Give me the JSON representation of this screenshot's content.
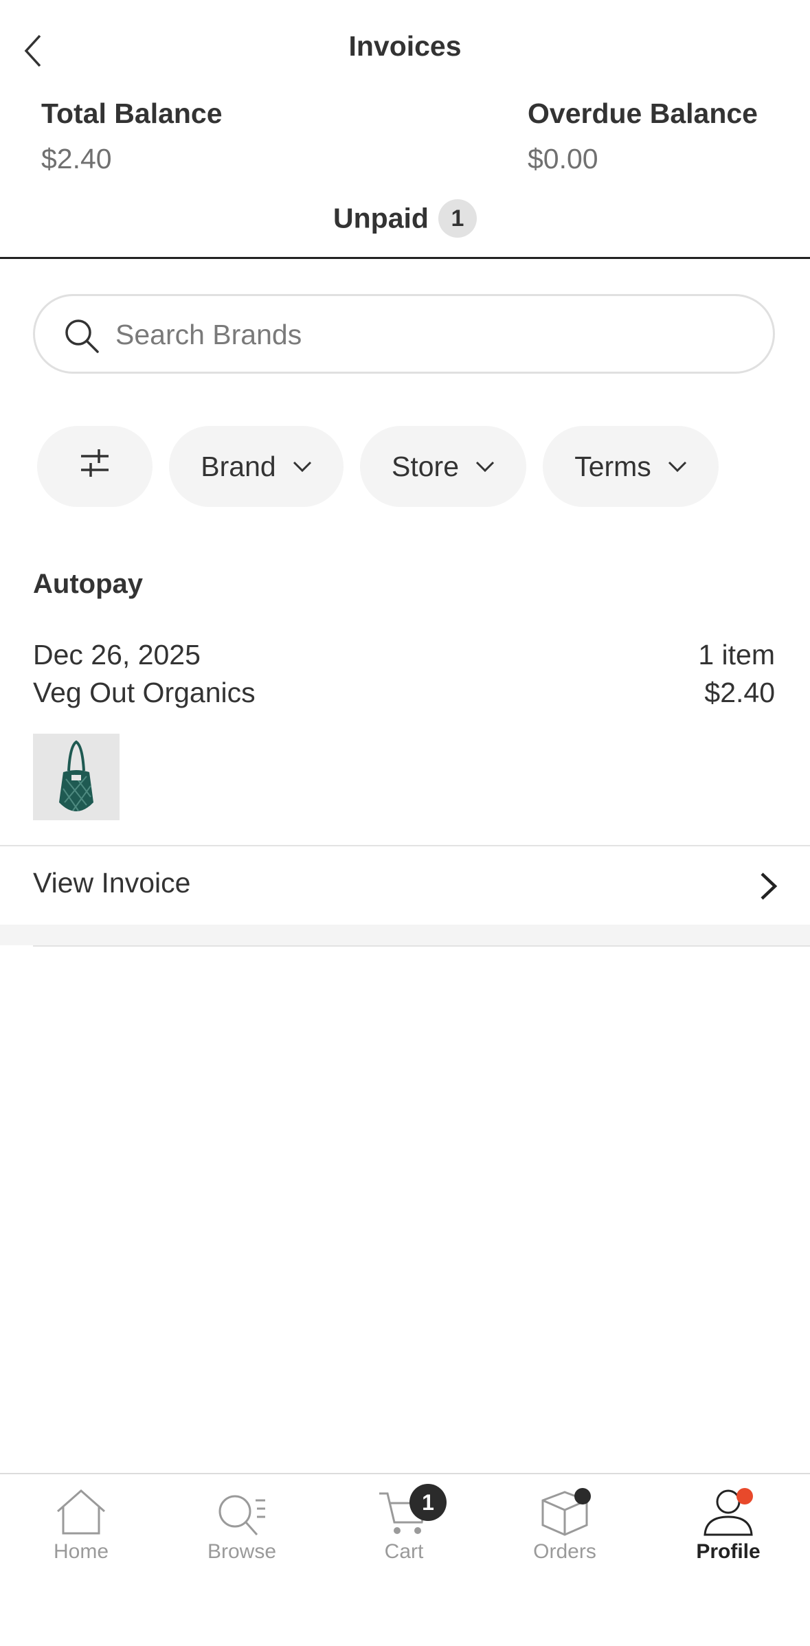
{
  "header": {
    "title": "Invoices"
  },
  "balances": {
    "total_label": "Total Balance",
    "total_value": "$2.40",
    "overdue_label": "Overdue Balance",
    "overdue_value": "$0.00"
  },
  "tabs": {
    "label": "Unpaid",
    "count": "1"
  },
  "search": {
    "placeholder": "Search Brands",
    "value": ""
  },
  "filters": [
    {
      "label": "Brand"
    },
    {
      "label": "Store"
    },
    {
      "label": "Terms"
    }
  ],
  "section": {
    "title": "Autopay",
    "invoice": {
      "date": "Dec 26, 2025",
      "store": "Veg Out Organics",
      "items": "1 item",
      "amount": "$2.40",
      "action_label": "View Invoice"
    }
  },
  "nav": {
    "items": [
      {
        "label": "Home",
        "icon": "home-icon"
      },
      {
        "label": "Browse",
        "icon": "browse-icon"
      },
      {
        "label": "Cart",
        "icon": "cart-icon",
        "badge": "1"
      },
      {
        "label": "Orders",
        "icon": "box-icon"
      },
      {
        "label": "Profile",
        "icon": "profile-icon",
        "active": true
      }
    ]
  },
  "colors": {
    "accent_dot_profile": "#e8492b",
    "dot_orders": "#2b2b2b",
    "product_green": "#1f5a52"
  }
}
